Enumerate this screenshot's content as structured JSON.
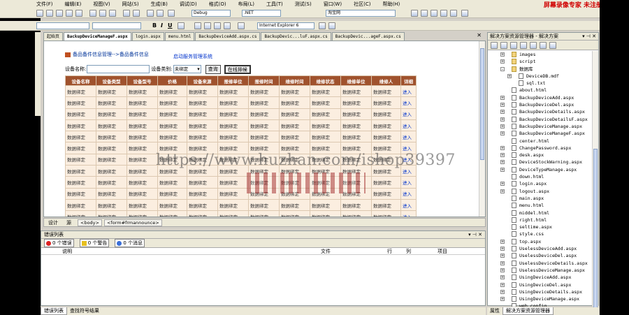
{
  "menu": {
    "items": [
      "文件(F)",
      "编辑(E)",
      "视图(V)",
      "网站(S)",
      "生成(B)",
      "调试(D)",
      "格式(O)",
      "布局(L)",
      "工具(T)",
      "测试(S)",
      "窗口(W)",
      "社区(C)",
      "帮助(H)"
    ],
    "watermark": "屏幕录像专家 未注册"
  },
  "toolbar": {
    "config": "Debug",
    "platform": ".NET",
    "search_text": "淘宝网",
    "target_browser": "Internet Explorer 6"
  },
  "doc_tabs": [
    "起始页",
    "BackupDeviceManageF.aspx",
    "login.aspx",
    "menu.html",
    "BackupDeviceAdd.aspx.cs",
    "BackupDevic...luF.aspx.cs",
    "BackupDevic...ageF.aspx.cs"
  ],
  "page": {
    "breadcrumb": "备品备件信息管理-->备品备件信息",
    "system_link": "启动服务管理系统",
    "search": {
      "name_label": "设备名称:",
      "type_label": "设备类别:",
      "type_value": "未绑定",
      "query_button": "查询",
      "focus_button": "在线排候"
    },
    "table": {
      "headers": [
        "设备名称",
        "设备类型",
        "设备型号",
        "价格",
        "设备来源",
        "报修单位",
        "报修时间",
        "维修时间",
        "维修状态",
        "维修单位",
        "维修人",
        "详细"
      ],
      "rows": [
        [
          "数据绑定",
          "数据绑定",
          "数据绑定",
          "数据绑定",
          "数据绑定",
          "数据绑定",
          "数据绑定",
          "数据绑定",
          "数据绑定",
          "数据绑定",
          "数据绑定",
          "进入"
        ],
        [
          "数据绑定",
          "数据绑定",
          "数据绑定",
          "数据绑定",
          "数据绑定",
          "数据绑定",
          "数据绑定",
          "数据绑定",
          "数据绑定",
          "数据绑定",
          "数据绑定",
          "进入"
        ],
        [
          "数据绑定",
          "数据绑定",
          "数据绑定",
          "数据绑定",
          "数据绑定",
          "数据绑定",
          "数据绑定",
          "数据绑定",
          "数据绑定",
          "数据绑定",
          "数据绑定",
          "进入"
        ],
        [
          "数据绑定",
          "数据绑定",
          "数据绑定",
          "数据绑定",
          "数据绑定",
          "数据绑定",
          "数据绑定",
          "数据绑定",
          "数据绑定",
          "数据绑定",
          "数据绑定",
          "进入"
        ],
        [
          "数据绑定",
          "数据绑定",
          "数据绑定",
          "数据绑定",
          "数据绑定",
          "数据绑定",
          "数据绑定",
          "数据绑定",
          "数据绑定",
          "数据绑定",
          "数据绑定",
          "进入"
        ],
        [
          "数据绑定",
          "数据绑定",
          "数据绑定",
          "数据绑定",
          "数据绑定",
          "数据绑定",
          "数据绑定",
          "数据绑定",
          "数据绑定",
          "数据绑定",
          "数据绑定",
          "进入"
        ],
        [
          "数据绑定",
          "数据绑定",
          "数据绑定",
          "数据绑定",
          "数据绑定",
          "数据绑定",
          "数据绑定",
          "数据绑定",
          "数据绑定",
          "数据绑定",
          "数据绑定",
          "进入"
        ],
        [
          "数据绑定",
          "数据绑定",
          "数据绑定",
          "数据绑定",
          "数据绑定",
          "数据绑定",
          "数据绑定",
          "数据绑定",
          "数据绑定",
          "数据绑定",
          "数据绑定",
          "进入"
        ],
        [
          "数据绑定",
          "数据绑定",
          "数据绑定",
          "数据绑定",
          "数据绑定",
          "数据绑定",
          "数据绑定",
          "数据绑定",
          "数据绑定",
          "数据绑定",
          "数据绑定",
          "进入"
        ],
        [
          "数据绑定",
          "数据绑定",
          "数据绑定",
          "数据绑定",
          "数据绑定",
          "数据绑定",
          "数据绑定",
          "数据绑定",
          "数据绑定",
          "数据绑定",
          "数据绑定",
          "进入"
        ],
        [
          "数据绑定",
          "数据绑定",
          "数据绑定",
          "数据绑定",
          "数据绑定",
          "数据绑定",
          "数据绑定",
          "数据绑定",
          "数据绑定",
          "数据绑定",
          "数据绑定",
          "进入"
        ],
        [
          "数据绑定",
          "数据绑定",
          "数据绑定",
          "数据绑定",
          "数据绑定",
          "数据绑定",
          "数据绑定",
          "数据绑定",
          "数据绑定",
          "数据绑定",
          "数据绑定",
          "进入"
        ]
      ]
    },
    "overlay_url": "https://www.huzhan.com/ishop39397"
  },
  "view_bar": {
    "design": "设计",
    "source": "源",
    "tags": [
      "<body>",
      "<form#frmannounce>"
    ]
  },
  "error_list": {
    "title": "错误列表",
    "errors": "0 个错误",
    "warnings": "0 个警告",
    "messages": "0 个消息",
    "columns": [
      "说明",
      "文件",
      "行",
      "列",
      "项目"
    ]
  },
  "bottom_tabs": [
    "错误列表",
    "查找符号结果"
  ],
  "solution": {
    "title": "解决方案资源管理器 - 解决方案",
    "tree": [
      {
        "label": "images",
        "type": "folder",
        "exp": "+"
      },
      {
        "label": "script",
        "type": "folder",
        "exp": "+"
      },
      {
        "label": "数据库",
        "type": "folder",
        "exp": "-"
      },
      {
        "label": "DeviceDB.mdf",
        "type": "file",
        "exp": "+",
        "indent": 1
      },
      {
        "label": "sql.txt",
        "type": "file",
        "exp": "",
        "indent": 1
      },
      {
        "label": "about.html",
        "type": "file",
        "exp": ""
      },
      {
        "label": "BackupDeviceAdd.aspx",
        "type": "file",
        "exp": "+"
      },
      {
        "label": "BackupDeviceDel.aspx",
        "type": "file",
        "exp": "+"
      },
      {
        "label": "BackupDeviceDetails.aspx",
        "type": "file",
        "exp": "+"
      },
      {
        "label": "BackupDeviceDetailsF.aspx",
        "type": "file",
        "exp": "+"
      },
      {
        "label": "BackupDeviceManage.aspx",
        "type": "file",
        "exp": "+"
      },
      {
        "label": "BackupDeviceManageF.aspx",
        "type": "file",
        "exp": "+"
      },
      {
        "label": "center.html",
        "type": "file",
        "exp": ""
      },
      {
        "label": "ChangePassword.aspx",
        "type": "file",
        "exp": "+"
      },
      {
        "label": "desk.aspx",
        "type": "file",
        "exp": "+"
      },
      {
        "label": "DeviceStockWarning.aspx",
        "type": "file",
        "exp": "+"
      },
      {
        "label": "DeviceTypeManage.aspx",
        "type": "file",
        "exp": "+"
      },
      {
        "label": "down.html",
        "type": "file",
        "exp": ""
      },
      {
        "label": "login.aspx",
        "type": "file",
        "exp": "+"
      },
      {
        "label": "logout.aspx",
        "type": "file",
        "exp": "+"
      },
      {
        "label": "main.aspx",
        "type": "file",
        "exp": ""
      },
      {
        "label": "menu.html",
        "type": "file",
        "exp": ""
      },
      {
        "label": "middel.html",
        "type": "file",
        "exp": ""
      },
      {
        "label": "right.html",
        "type": "file",
        "exp": ""
      },
      {
        "label": "seltime.aspx",
        "type": "file",
        "exp": ""
      },
      {
        "label": "style.css",
        "type": "file",
        "exp": ""
      },
      {
        "label": "top.aspx",
        "type": "file",
        "exp": "+"
      },
      {
        "label": "UselessDeviceAdd.aspx",
        "type": "file",
        "exp": "+"
      },
      {
        "label": "UselessDeviceDel.aspx",
        "type": "file",
        "exp": "+"
      },
      {
        "label": "UselessDeviceDetails.aspx",
        "type": "file",
        "exp": "+"
      },
      {
        "label": "UselessDeviceManage.aspx",
        "type": "file",
        "exp": "+"
      },
      {
        "label": "UsingDeviceAdd.aspx",
        "type": "file",
        "exp": "+"
      },
      {
        "label": "UsingDeviceDel.aspx",
        "type": "file",
        "exp": "+"
      },
      {
        "label": "UsingDeviceDetails.aspx",
        "type": "file",
        "exp": "+"
      },
      {
        "label": "UsingDeviceManage.aspx",
        "type": "file",
        "exp": "+"
      },
      {
        "label": "web.config",
        "type": "file",
        "exp": ""
      }
    ],
    "bottom_tabs": [
      "属性",
      "解决方案资源管理器"
    ]
  }
}
